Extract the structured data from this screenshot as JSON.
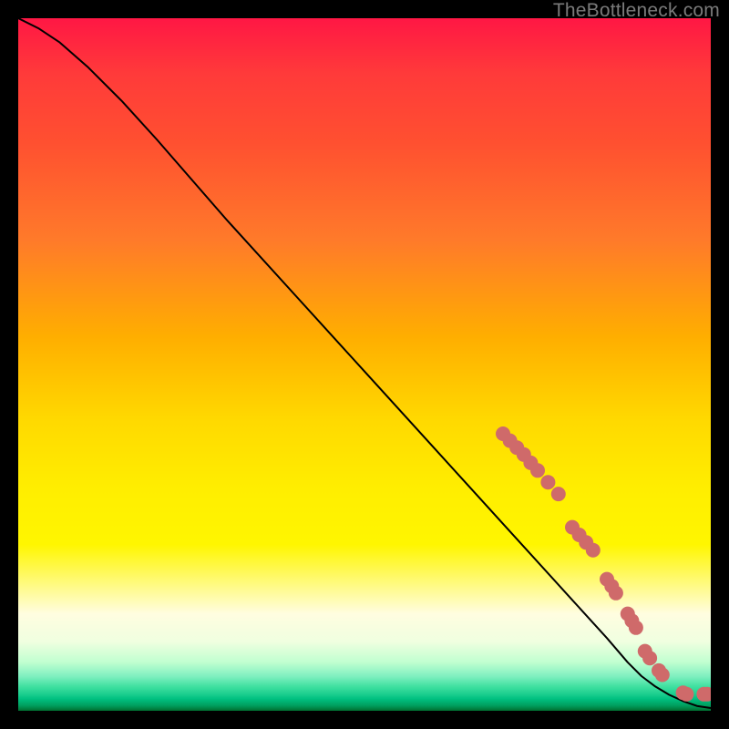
{
  "watermark": "TheBottleneck.com",
  "chart_data": {
    "type": "line",
    "title": "",
    "xlabel": "",
    "ylabel": "",
    "xlim": [
      0,
      100
    ],
    "ylim": [
      0,
      100
    ],
    "background": "heat-gradient-red-to-green",
    "series": [
      {
        "name": "curve",
        "x": [
          0,
          3,
          6,
          10,
          15,
          20,
          30,
          40,
          50,
          60,
          70,
          80,
          85,
          88,
          90,
          92,
          94,
          96,
          98,
          100
        ],
        "y": [
          100,
          98.5,
          96.5,
          93,
          88,
          82.5,
          71,
          60,
          49,
          38,
          27,
          16,
          10.5,
          7,
          5,
          3.5,
          2.3,
          1.4,
          0.7,
          0.4
        ]
      }
    ],
    "points": {
      "name": "markers",
      "color": "#cf6a6a",
      "radius": 8,
      "data": [
        {
          "x": 70,
          "y": 40
        },
        {
          "x": 71,
          "y": 39
        },
        {
          "x": 72,
          "y": 38
        },
        {
          "x": 73,
          "y": 37
        },
        {
          "x": 74,
          "y": 35.8
        },
        {
          "x": 75,
          "y": 34.7
        },
        {
          "x": 76.5,
          "y": 33
        },
        {
          "x": 78,
          "y": 31.3
        },
        {
          "x": 80,
          "y": 26.5
        },
        {
          "x": 81,
          "y": 25.4
        },
        {
          "x": 82,
          "y": 24.3
        },
        {
          "x": 83,
          "y": 23.2
        },
        {
          "x": 85,
          "y": 19
        },
        {
          "x": 85.7,
          "y": 18
        },
        {
          "x": 86.3,
          "y": 17
        },
        {
          "x": 88,
          "y": 14
        },
        {
          "x": 88.6,
          "y": 13
        },
        {
          "x": 89.2,
          "y": 12
        },
        {
          "x": 90.5,
          "y": 8.6
        },
        {
          "x": 91.2,
          "y": 7.6
        },
        {
          "x": 92.5,
          "y": 5.8
        },
        {
          "x": 93,
          "y": 5.2
        },
        {
          "x": 96,
          "y": 2.6
        },
        {
          "x": 96.5,
          "y": 2.4
        },
        {
          "x": 99,
          "y": 2.4
        },
        {
          "x": 99.5,
          "y": 2.4
        }
      ]
    }
  }
}
